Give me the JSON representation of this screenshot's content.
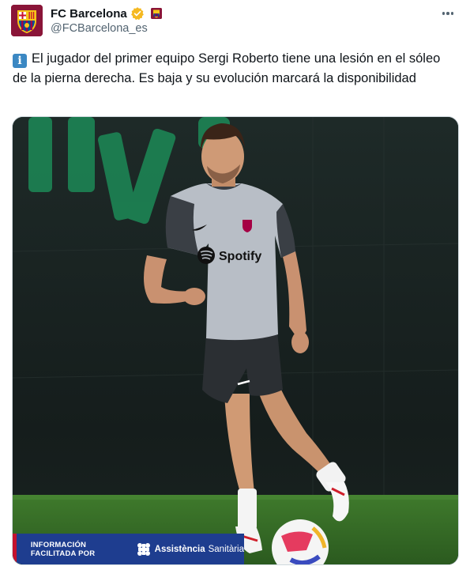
{
  "account": {
    "display_name": "FC Barcelona",
    "handle": "@FCBarcelona_es",
    "verified": true,
    "badge_color": "#f5b921",
    "brand_color": "#8a1538"
  },
  "tweet": {
    "icon": "information-icon",
    "text": "El jugador del primer equipo Sergi Roberto tiene una lesión en el sóleo de la pierna derecha. Es baja y su evolución marcará la disponibilidad"
  },
  "media": {
    "jersey_sponsor": "Spotify",
    "caption_prefix": "INFORMACIÓN FACILITADA POR",
    "caption_brand_bold": "Assistència",
    "caption_brand_regular": "Sanitària",
    "caption_bar_color": "#1e3d8f"
  }
}
